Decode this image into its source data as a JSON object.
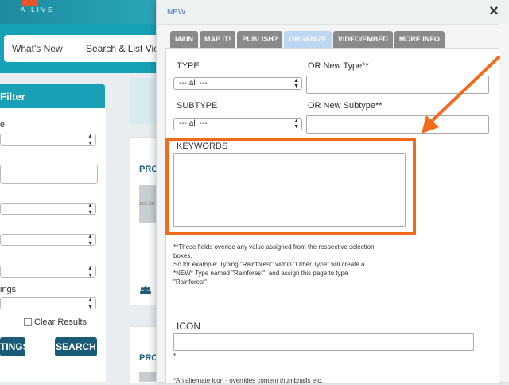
{
  "background": {
    "logo_text": "A LIVE",
    "nav": [
      "What's New",
      "Search & List View"
    ],
    "filter_title": "Filter",
    "filter_labels": [
      "e",
      "ings"
    ],
    "clear_results": "Clear Results",
    "buttons": [
      "TINGS",
      "SEARCH"
    ],
    "card_title": "PRO",
    "card_image_caption": "AGE CO"
  },
  "modal": {
    "title": "NEW",
    "close_glyph": "×",
    "tabs": [
      "MAIN",
      "MAP IT!",
      "PUBLISH?",
      "ORGANIZE",
      "VIDEO/EMBED",
      "MORE INFO"
    ],
    "active_tab": "ORGANIZE",
    "type_label": "TYPE",
    "type_value": "--- all ---",
    "new_type_label": "OR New Type**",
    "new_type_value": "",
    "subtype_label": "SUBTYPE",
    "subtype_value": "--- all ---",
    "new_subtype_label": "OR New Subtype**",
    "new_subtype_value": "",
    "keywords_label": "KEYWORDS",
    "keywords_value": "",
    "note_line1": "**These fields overide any value assigned from the respective selection",
    "note_line2": "boxes.",
    "note_line3": "So for example: Typing \"Rainforest\" within \"Other Type\" will create a",
    "note_line4": "*NEW* Type named \"Rainforest\", and assign this page to type",
    "note_line5": "\"Rainforest\".",
    "icon_label": "ICON",
    "icon_value": "",
    "icon_star": "*",
    "icon_note": "*An alternate icon - overrides content thumbnails etc."
  },
  "annotation": {
    "color": "#f26b1d"
  }
}
